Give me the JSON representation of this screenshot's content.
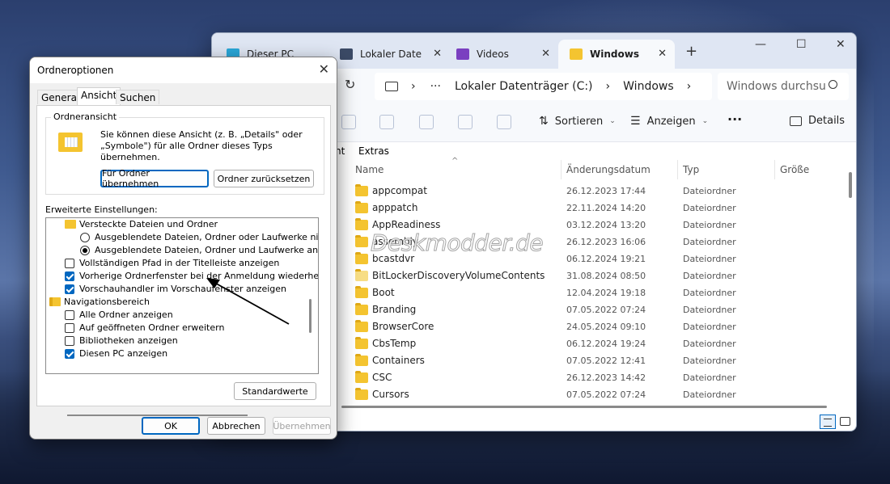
{
  "explorer": {
    "tabs": [
      {
        "label": "Dieser PC",
        "icon": "monitor-icon"
      },
      {
        "label": "Lokaler Date",
        "icon": "drive-icon"
      },
      {
        "label": "Videos",
        "icon": "video-icon"
      },
      {
        "label": "Windows",
        "icon": "folder-icon"
      }
    ],
    "tab_close": "✕",
    "new_tab": "+",
    "window_buttons": {
      "minimize": "—",
      "maximize": "☐",
      "close": "✕"
    },
    "refresh": "↻",
    "address": {
      "root": "›",
      "ellipsis": "···",
      "sep": "›",
      "drive": "Lokaler Datenträger (C:)",
      "folder": "Windows",
      "chevron": "›"
    },
    "search_placeholder": "Windows durchsu",
    "toolbar": {
      "sort": "Sortieren",
      "view": "Anzeigen",
      "more": "···",
      "details": "Details"
    },
    "menu": {
      "partial": "nt",
      "extras": "Extras"
    },
    "columns": {
      "name": "Name",
      "date": "Änderungsdatum",
      "type": "Typ",
      "size": "Größe"
    },
    "rows": [
      {
        "name": "appcompat",
        "date": "26.12.2023 17:44",
        "type": "Dateiordner"
      },
      {
        "name": "apppatch",
        "date": "22.11.2024 14:20",
        "type": "Dateiordner"
      },
      {
        "name": "AppReadiness",
        "date": "03.12.2024 13:20",
        "type": "Dateiordner"
      },
      {
        "name": "assembly",
        "date": "26.12.2023 16:06",
        "type": "Dateiordner"
      },
      {
        "name": "bcastdvr",
        "date": "06.12.2024 19:21",
        "type": "Dateiordner"
      },
      {
        "name": "BitLockerDiscoveryVolumeContents",
        "date": "31.08.2024 08:50",
        "type": "Dateiordner"
      },
      {
        "name": "Boot",
        "date": "12.04.2024 19:18",
        "type": "Dateiordner"
      },
      {
        "name": "Branding",
        "date": "07.05.2022 07:24",
        "type": "Dateiordner"
      },
      {
        "name": "BrowserCore",
        "date": "24.05.2024 09:10",
        "type": "Dateiordner"
      },
      {
        "name": "CbsTemp",
        "date": "06.12.2024 19:24",
        "type": "Dateiordner"
      },
      {
        "name": "Containers",
        "date": "07.05.2022 12:41",
        "type": "Dateiordner"
      },
      {
        "name": "CSC",
        "date": "26.12.2023 14:42",
        "type": "Dateiordner"
      },
      {
        "name": "Cursors",
        "date": "07.05.2022 07:24",
        "type": "Dateiordner"
      }
    ],
    "watermark": "Deskmodder.de"
  },
  "dialog": {
    "title": "Ordneroptionen",
    "close": "✕",
    "tabs": [
      "General",
      "Ansicht",
      "Suchen"
    ],
    "group_title": "Ordneransicht",
    "group_text": "Sie können diese Ansicht (z. B. „Details\" oder „Symbole\") für alle Ordner dieses Typs übernehmen.",
    "btn_apply_all": "Für Ordner übernehmen",
    "btn_reset": "Ordner zurücksetzen",
    "advanced_label": "Erweiterte Einstellungen:",
    "tree": [
      "Versteckte Dateien und Ordner",
      "Ausgeblendete Dateien, Ordner oder Laufwerke nicht a",
      "Ausgeblendete Dateien, Ordner und Laufwerke anzeige",
      "Vollständigen Pfad in der Titelleiste anzeigen",
      "Vorherige Ordnerfenster bei der Anmeldung wiederherstellen",
      "Vorschauhandler im Vorschaufenster anzeigen",
      "Navigationsbereich",
      "Alle Ordner anzeigen",
      "Auf geöffneten Ordner erweitern",
      "Bibliotheken anzeigen",
      "Diesen PC anzeigen"
    ],
    "btn_defaults": "Standardwerte",
    "btn_ok": "OK",
    "btn_cancel": "Abbrechen",
    "btn_apply": "Übernehmen"
  },
  "colors": {
    "accent": "#0067c0",
    "folder": "#f4c430"
  }
}
